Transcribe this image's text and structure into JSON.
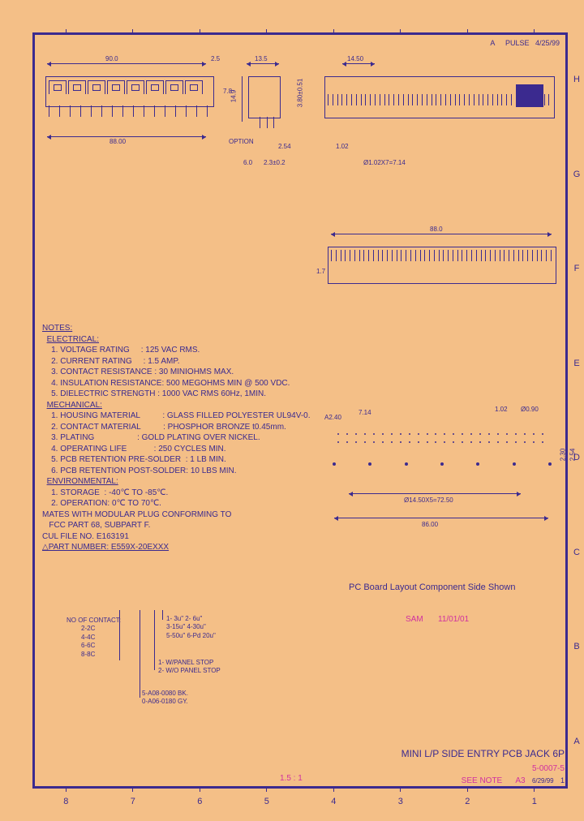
{
  "ruler_cols": [
    "8",
    "7",
    "6",
    "5",
    "4",
    "3",
    "2",
    "1"
  ],
  "ruler_rows": [
    "H",
    "G",
    "F",
    "E",
    "D",
    "C",
    "B",
    "A"
  ],
  "header": {
    "mark": "4/25/99",
    "rev": "A",
    "name": "PULSE"
  },
  "dims": {
    "front_width": "90.0",
    "front_height": "7.8",
    "front_top": "2.5",
    "front_pitch": "88.00",
    "side_width": "13.5",
    "side_height": "14.9",
    "side_pin": "3.80±0.51",
    "side_offset": "2.54",
    "side_body": "2.3±0.2",
    "side_base": "6.0",
    "option_label": "OPTION",
    "top_width": "14.50",
    "top_pin": "1.02",
    "top_pins_calc": "Ø1.02X7=7.14",
    "pcb_len": "88.0",
    "pcb_depth": "1.7",
    "fp_hole": "A2.40",
    "fp_small": "Ø0.90",
    "fp_col": "7.14",
    "fp_pitch_calc": "Ø14.50X5=72.50",
    "fp_span": "86.00",
    "fp_a": "1.02",
    "fp_b": "2.30",
    "fp_c": "2.54"
  },
  "notes_title": "NOTES:",
  "elec_title": "ELECTRICAL:",
  "elec": [
    "1. VOLTAGE RATING     : 125 VAC RMS.",
    "2. CURRENT RATING     : 1.5 AMP.",
    "3. CONTACT RESISTANCE : 30 MINIOHMS MAX.",
    "4. INSULATION RESISTANCE: 500 MEGOHMS MIN @ 500 VDC.",
    "5. DIELECTRIC STRENGTH : 1000 VAC RMS 60Hz, 1MIN."
  ],
  "mech_title": "MECHANICAL:",
  "mech": [
    "1. HOUSING MATERIAL          : GLASS FILLED POLYESTER UL94V-0.",
    "2. CONTACT MATERIAL          : PHOSPHOR BRONZE t0.45mm.",
    "3. PLATING                   : GOLD PLATING OVER NICKEL.",
    "4. OPERATING LIFE            : 250 CYCLES MIN.",
    "5. PCB RETENTION PRE-SOLDER  : 1 LB MIN.",
    "6. PCB RETENTION POST-SOLDER: 10 LBS MIN."
  ],
  "env_title": "ENVIRONMENTAL:",
  "env": [
    "1. STORAGE  : -40℃ TO -85℃.",
    "2. OPERATION: 0℃ TO 70℃."
  ],
  "mates": "MATES WITH MODULAR PLUG CONFORMING TO",
  "mates2": "   FCC PART 68, SUBPART F.",
  "cul": "CUL FILE NO. E163191",
  "part_title": "△PART NUMBER: E559X-20EXXX",
  "contacts_label": "NO OF CONTACT:",
  "contacts": [
    "2-2C",
    "4-4C",
    "6-6C",
    "8-8C"
  ],
  "gold_opts": [
    "1- 3u\"   2- 6u\"",
    "3-15u\"  4-30u\"",
    "5-50u\"  6-Pd 20u\""
  ],
  "panel_opts": [
    "1- W/PANEL STOP",
    "2- W/O PANEL STOP"
  ],
  "color_opts": [
    "5-A08-0080 BK.",
    "0-A06-0180 GY."
  ],
  "pcb_label": "PC Board Layout Component Side Shown",
  "sig1": "SAM",
  "sig2": "11/01/01",
  "title": "MINI L/P SIDE ENTRY PCB JACK 6P",
  "doc_no": "5-0007-5",
  "note_ref": "SEE NOTE",
  "sheet": "A3",
  "scale": "1.5 : 1",
  "page": "1",
  "date": "6/29/99"
}
